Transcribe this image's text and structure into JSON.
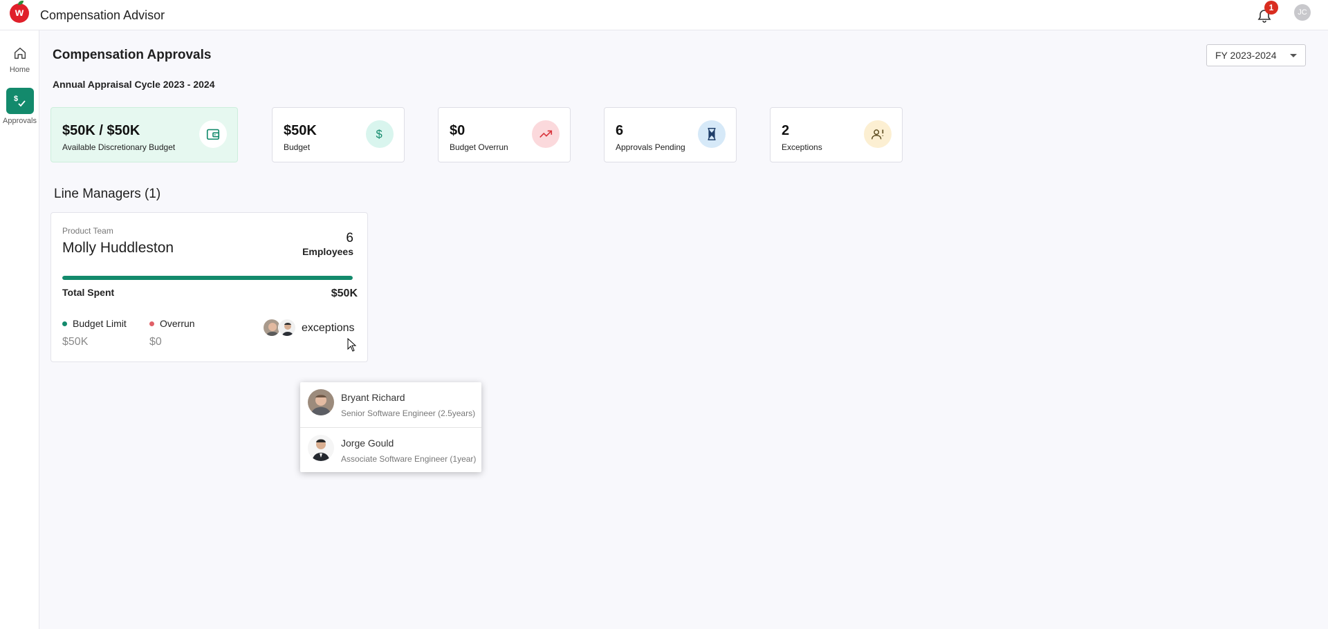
{
  "app": {
    "title": "Compensation Advisor",
    "notifications": "1",
    "user_initials": "JC"
  },
  "sidebar": {
    "items": [
      {
        "label": "Home",
        "icon": "home-icon"
      },
      {
        "label": "Approvals",
        "icon": "approvals-icon",
        "active": true
      }
    ]
  },
  "page": {
    "title": "Compensation Approvals",
    "subtitle": "Annual Appraisal Cycle 2023 - 2024",
    "fiscal_year": "FY 2023-2024"
  },
  "stats": [
    {
      "value": "$50K / $50K",
      "label": "Available Discretionary Budget",
      "icon": "wallet-icon",
      "color": "#138a6c"
    },
    {
      "value": "$50K",
      "label": "Budget",
      "icon": "dollar-icon",
      "color": "#138a6c"
    },
    {
      "value": "$0",
      "label": "Budget Overrun",
      "icon": "trending-up-icon",
      "color": "#d9343c"
    },
    {
      "value": "6",
      "label": "Approvals Pending",
      "icon": "hourglass-icon",
      "color": "#1f3f6a"
    },
    {
      "value": "2",
      "label": "Exceptions",
      "icon": "person-alert-icon",
      "color": "#a0761e"
    }
  ],
  "line_managers": {
    "title": "Line Managers (1)",
    "cards": [
      {
        "team": "Product Team",
        "name": "Molly Huddleston",
        "employee_count": "6",
        "employee_label": "Employees",
        "progress": 1.0,
        "total_spent_label": "Total Spent",
        "total_spent": "$50K",
        "budget_limit_label": "Budget Limit",
        "budget_limit": "$50K",
        "overrun_label": "Overrun",
        "overrun": "$0",
        "exceptions_label": "exceptions"
      }
    ]
  },
  "exceptions_popup": [
    {
      "name": "Bryant Richard",
      "role": "Senior Software Engineer (2.5years)"
    },
    {
      "name": "Jorge Gould",
      "role": "Associate Software Engineer (1year)"
    }
  ]
}
